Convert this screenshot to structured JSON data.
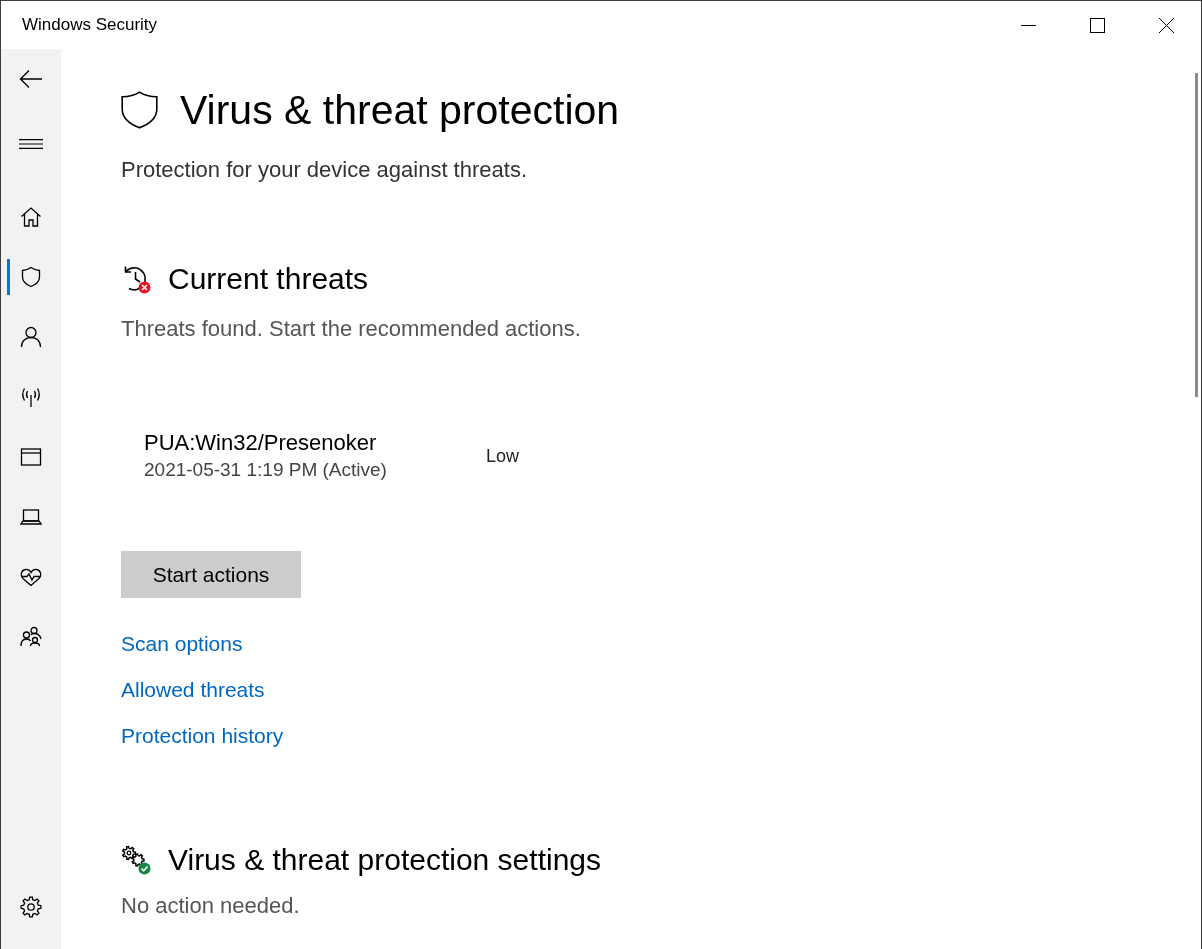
{
  "window": {
    "title": "Windows Security"
  },
  "sidebar": {
    "items": [
      {
        "selected": false
      },
      {
        "selected": true
      },
      {
        "selected": false
      },
      {
        "selected": false
      },
      {
        "selected": false
      },
      {
        "selected": false
      },
      {
        "selected": false
      },
      {
        "selected": false
      }
    ]
  },
  "page": {
    "title": "Virus & threat protection",
    "subtitle": "Protection for your device against threats."
  },
  "current_threats": {
    "heading": "Current threats",
    "status": "Threats found. Start the recommended actions.",
    "threats": [
      {
        "name": "PUA:Win32/Presenoker",
        "detected": "2021-05-31 1:19 PM (Active)",
        "severity": "Low"
      }
    ],
    "button": "Start actions",
    "links": [
      "Scan options",
      "Allowed threats",
      "Protection history"
    ]
  },
  "settings": {
    "heading": "Virus & threat protection settings",
    "status": "No action needed."
  }
}
